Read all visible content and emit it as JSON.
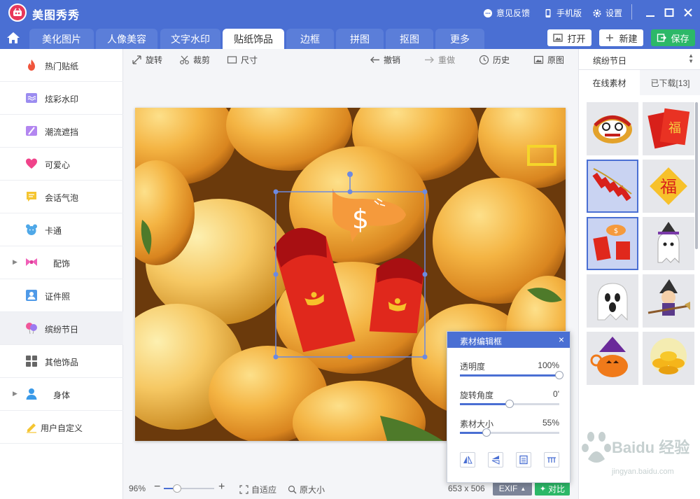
{
  "app": {
    "title": "美图秀秀"
  },
  "titlebar": {
    "feedback": "意见反馈",
    "mobile": "手机版",
    "settings": "设置"
  },
  "tabs": [
    {
      "label": "美化图片"
    },
    {
      "label": "人像美容"
    },
    {
      "label": "文字水印"
    },
    {
      "label": "贴纸饰品",
      "active": true
    },
    {
      "label": "边框"
    },
    {
      "label": "拼图"
    },
    {
      "label": "抠图"
    },
    {
      "label": "更多"
    }
  ],
  "actions": {
    "open": "打开",
    "new": "新建",
    "save": "保存"
  },
  "sidebar": {
    "items": [
      {
        "label": "热门贴纸",
        "icon": "flame-icon"
      },
      {
        "label": "炫彩水印",
        "icon": "watermark-icon"
      },
      {
        "label": "潮流遮挡",
        "icon": "block-icon"
      },
      {
        "label": "可爱心",
        "icon": "heart-icon"
      },
      {
        "label": "会话气泡",
        "icon": "speech-bubble-icon"
      },
      {
        "label": "卡通",
        "icon": "bear-icon"
      },
      {
        "label": "配饰",
        "icon": "bow-icon",
        "expandable": true
      },
      {
        "label": "证件照",
        "icon": "id-photo-icon"
      },
      {
        "label": "缤纷节日",
        "icon": "balloon-icon",
        "active": true
      },
      {
        "label": "其他饰品",
        "icon": "grid-icon"
      },
      {
        "label": "身体",
        "icon": "person-icon",
        "expandable": true
      },
      {
        "label": "用户自定义",
        "icon": "pencil-icon"
      }
    ]
  },
  "toolbar": {
    "rotate": "旋转",
    "crop": "裁剪",
    "size": "尺寸",
    "undo": "撤销",
    "redo": "重做",
    "history": "历史",
    "original": "原图"
  },
  "status": {
    "zoom": "96%",
    "zoom_level": 0.27,
    "fit": "自适应",
    "original_size": "原大小",
    "dimensions": "653 x 506",
    "exif": "EXIF",
    "compare": "对比"
  },
  "material_panel": {
    "title": "素材编辑框",
    "close": "×",
    "opacity_label": "透明度",
    "opacity_value": "100%",
    "opacity_level": 1.0,
    "rotation_label": "旋转角度",
    "rotation_value": "0'",
    "rotation_level": 0.5,
    "size_label": "素材大小",
    "size_value": "55%",
    "size_level": 0.27
  },
  "right_panel": {
    "category": "缤纷节日",
    "tab_online": "在线素材",
    "tab_downloaded": "已下载[13]"
  },
  "colors": {
    "accent": "#4a6fd3",
    "save": "#2cb868",
    "red_envelope": "#e0281c",
    "bubble": "#f59a3c"
  }
}
